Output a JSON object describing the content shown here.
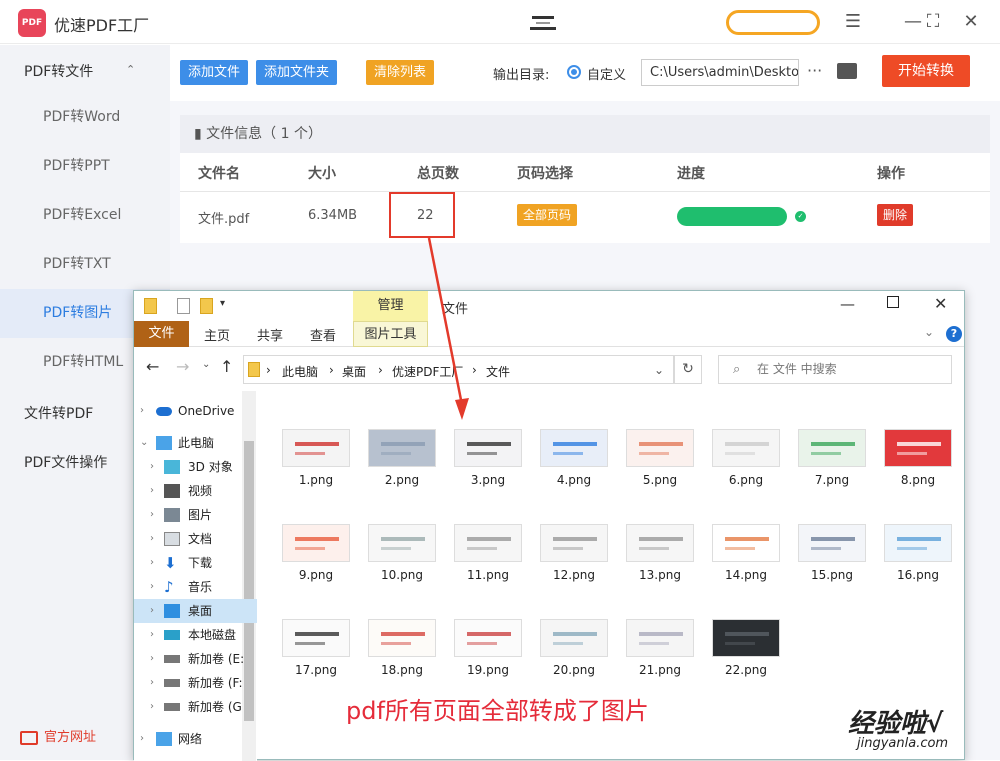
{
  "app": {
    "title": "优速PDF工厂"
  },
  "window_controls": {
    "menu": "☰",
    "maximize": "⛶",
    "close": "✕"
  },
  "sidebar": {
    "groups": [
      {
        "label": "PDF转文件",
        "caret": "⌃"
      },
      {
        "label": "文件转PDF",
        "caret": "⌄"
      },
      {
        "label": "PDF文件操作",
        "caret": "⌄"
      }
    ],
    "items": [
      {
        "label": "PDF转Word"
      },
      {
        "label": "PDF转PPT"
      },
      {
        "label": "PDF转Excel"
      },
      {
        "label": "PDF转TXT"
      },
      {
        "label": "PDF转图片",
        "active": true
      },
      {
        "label": "PDF转HTML"
      }
    ],
    "official_site": "官方网址"
  },
  "toolbar": {
    "add_file": "添加文件",
    "add_folder": "添加文件夹",
    "clear_list": "清除列表",
    "output_dir_label": "输出目录:",
    "radio_custom": "自定义",
    "output_path": "C:\\Users\\admin\\Deskto",
    "more": "···",
    "start": "开始转换"
  },
  "file_info": {
    "header": "文件信息（ 1 个）",
    "columns": [
      "文件名",
      "大小",
      "总页数",
      "页码选择",
      "进度",
      "操作"
    ],
    "row": {
      "name": "文件.pdf",
      "size": "6.34MB",
      "pages": "22",
      "page_select": "全部页码",
      "progress": 1.0,
      "action": "删除"
    }
  },
  "explorer": {
    "manage_tab": "管理",
    "title": "文件",
    "ribbon": {
      "file": "文件",
      "home": "主页",
      "share": "共享",
      "view": "查看",
      "picture_tools": "图片工具"
    },
    "breadcrumb": [
      "此电脑",
      "桌面",
      "优速PDF工厂",
      "文件"
    ],
    "search_placeholder": "在 文件 中搜索",
    "tree": [
      {
        "label": "OneDrive"
      },
      {
        "label": "此电脑"
      },
      {
        "label": "3D 对象"
      },
      {
        "label": "视频"
      },
      {
        "label": "图片"
      },
      {
        "label": "文档"
      },
      {
        "label": "下载"
      },
      {
        "label": "音乐"
      },
      {
        "label": "桌面",
        "selected": true
      },
      {
        "label": "本地磁盘"
      },
      {
        "label": "新加卷 (E:"
      },
      {
        "label": "新加卷 (F:"
      },
      {
        "label": "新加卷 (G"
      },
      {
        "label": "网络"
      }
    ],
    "files": [
      "1.png",
      "2.png",
      "3.png",
      "4.png",
      "5.png",
      "6.png",
      "7.png",
      "8.png",
      "9.png",
      "10.png",
      "11.png",
      "12.png",
      "13.png",
      "14.png",
      "15.png",
      "16.png",
      "17.png",
      "18.png",
      "19.png",
      "20.png",
      "21.png",
      "22.png"
    ]
  },
  "caption": "pdf所有页面全部转成了图片",
  "watermark": {
    "text": "经验啦√",
    "url": "jingyanla.com"
  },
  "colors": {
    "accent_blue": "#3d8ee8",
    "orange": "#f0a323",
    "red": "#e03b2a",
    "green": "#1fbe6e",
    "caption_red": "#e52c3a"
  }
}
